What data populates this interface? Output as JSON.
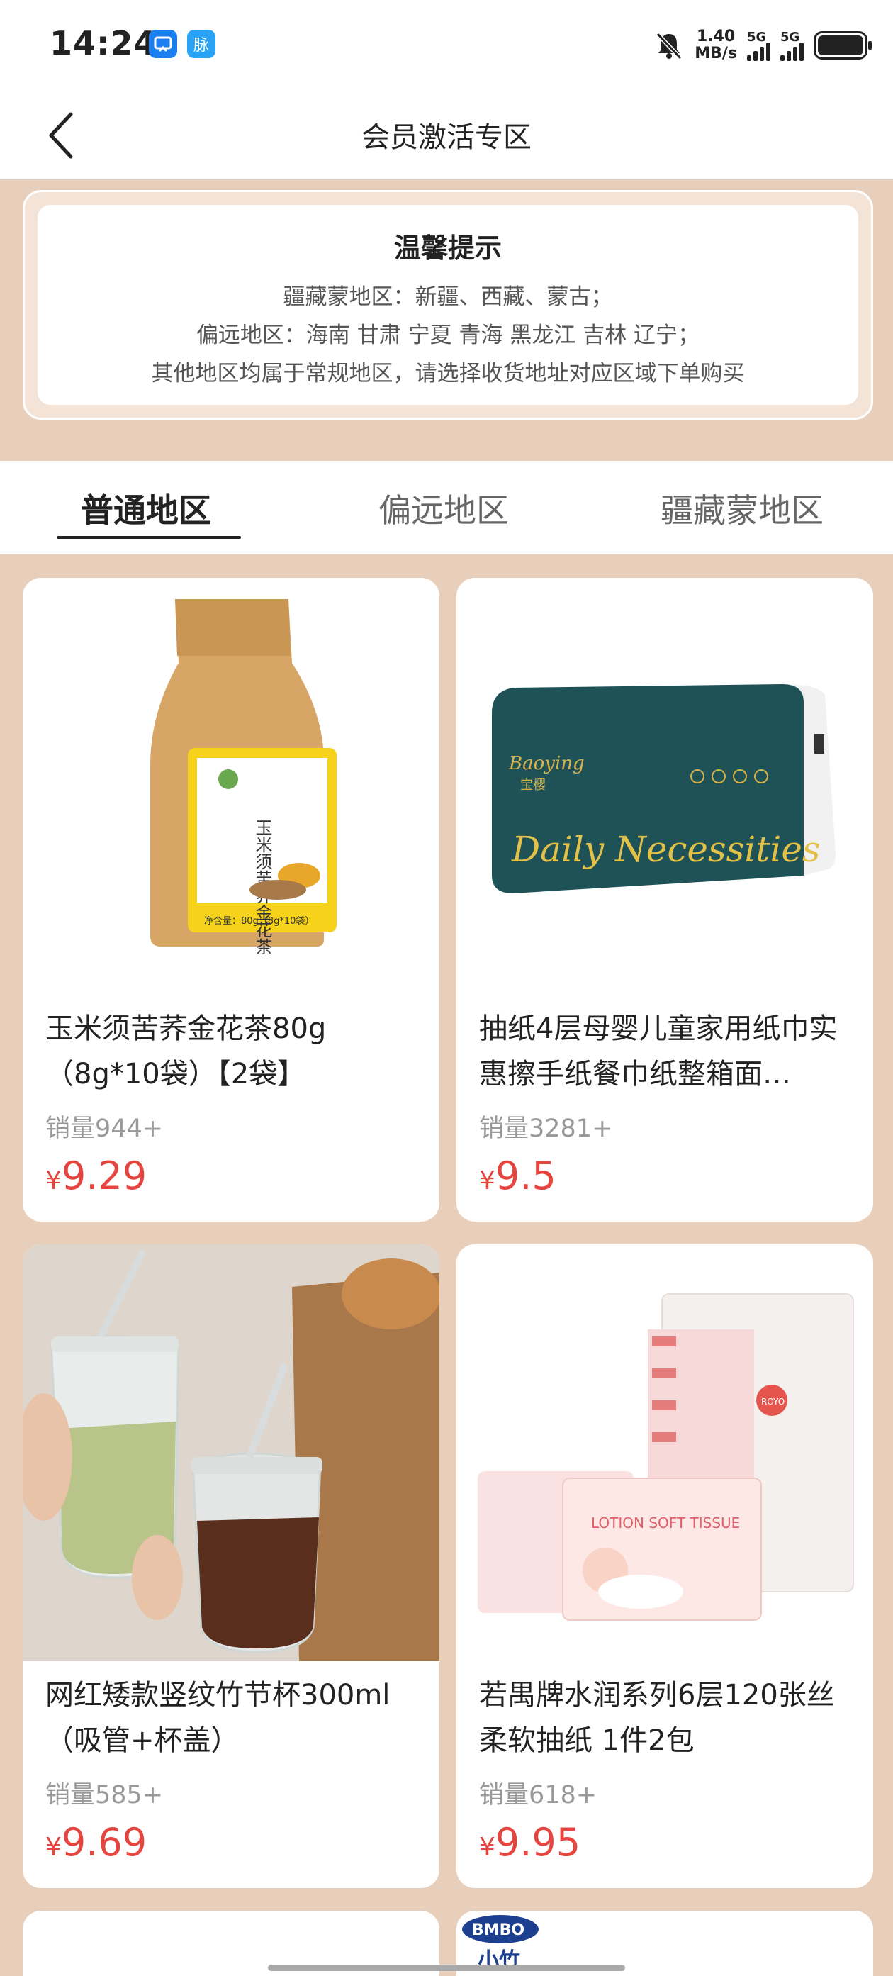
{
  "status_bar": {
    "time": "14:24",
    "net_speed_value": "1.40",
    "net_speed_unit": "MB/s",
    "sim1_label": "5G",
    "sim2_label": "5G",
    "app_icon_2_text": "脉",
    "icons": [
      "browser-app-icon",
      "chat-app-icon",
      "mute-bell-icon",
      "signal-icon",
      "battery-icon"
    ]
  },
  "nav": {
    "title": "会员激活专区"
  },
  "notice": {
    "title": "温馨提示",
    "lines": [
      "疆藏蒙地区：新疆、西藏、蒙古；",
      "偏远地区：海南 甘肃 宁夏 青海 黑龙江 吉林  辽宁；",
      "其他地区均属于常规地区，请选择收货地址对应区域下单购买"
    ]
  },
  "tabs": [
    {
      "label": "普通地区",
      "active": true
    },
    {
      "label": "偏远地区",
      "active": false
    },
    {
      "label": "疆藏蒙地区",
      "active": false
    }
  ],
  "products": [
    {
      "name": "玉米须苦荞金花茶80g（8g*10袋）【2袋】",
      "sales": "销量944+",
      "currency": "¥",
      "price": "9.29",
      "image": "tea-bag",
      "package_text": "玉米须苦荞金花茶",
      "package_weight": "净含量：80g（8g*10袋）"
    },
    {
      "name": "抽纸4层母婴儿童家用纸巾实惠擦手纸餐巾纸整箱面…",
      "sales": "销量3281+",
      "currency": "¥",
      "price": "9.5",
      "image": "tissue-box",
      "package_brand": "Baoying",
      "package_brand_cn": "宝樱",
      "package_text": "Daily Necessities"
    },
    {
      "name": "网红矮款竖纹竹节杯300ml（吸管+杯盖）",
      "sales": "销量585+",
      "currency": "¥",
      "price": "9.69",
      "image": "glass-cups"
    },
    {
      "name": "若禺牌水润系列6层120张丝柔软抽纸 1件2包",
      "sales": "销量618+",
      "currency": "¥",
      "price": "9.95",
      "image": "soft-tissue",
      "package_brand": "ROYO",
      "package_text": "LOTION SOFT TISSUE"
    },
    {
      "image": "partial-product"
    },
    {
      "image": "partial-product",
      "brand": "BMBO",
      "brand_cn": "小竹"
    }
  ],
  "colors": {
    "page_bg": "#e8cfbb",
    "price": "#e5443f",
    "accent_text": "#222222"
  }
}
